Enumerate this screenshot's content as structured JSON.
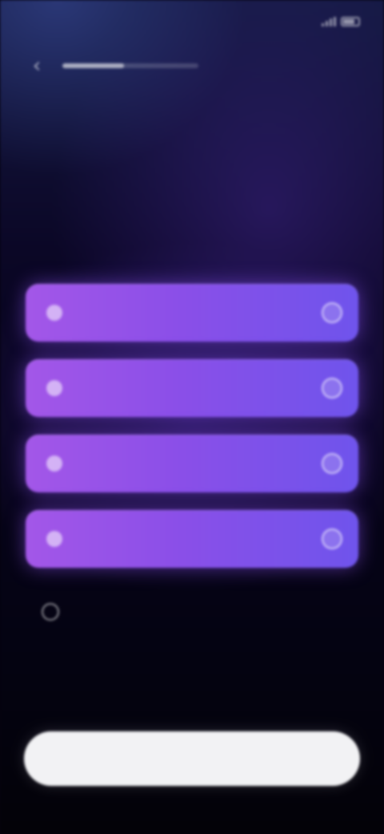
{
  "status_bar": {
    "time": "",
    "battery_icon": "battery-icon",
    "signal_icon": "signal-icon"
  },
  "nav": {
    "back_icon": "chevron-left-icon",
    "progress": 0.45
  },
  "question": {
    "text": ""
  },
  "options": [
    {
      "label": "",
      "icon": "option-icon",
      "selected": false
    },
    {
      "label": "",
      "icon": "option-icon",
      "selected": false
    },
    {
      "label": "",
      "icon": "option-icon",
      "selected": false
    },
    {
      "label": "",
      "icon": "option-icon",
      "selected": false
    }
  ],
  "other_option": {
    "label": "",
    "icon": "circle-icon"
  },
  "continue_button": {
    "label": ""
  },
  "colors": {
    "background_top": "#151a44",
    "background_bottom": "#030208",
    "option_start": "#a357e8",
    "option_end": "#6f54ec",
    "button": "#f2f2f4"
  }
}
